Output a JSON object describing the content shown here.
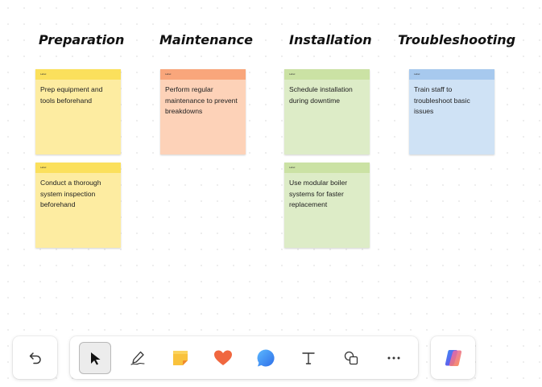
{
  "columns": [
    {
      "title": "Preparation"
    },
    {
      "title": "Maintenance"
    },
    {
      "title": "Installation"
    },
    {
      "title": "Troubleshooting"
    }
  ],
  "notes": [
    {
      "tag": "Label",
      "text": "Prep equipment and tools beforehand",
      "color": "#fdeca1"
    },
    {
      "tag": "Label",
      "text": "Conduct a thorough system inspection beforehand",
      "color": "#fdeca1"
    },
    {
      "tag": "Label",
      "text": "Perform regular maintenance to prevent breakdowns",
      "color": "#fdd2b8"
    },
    {
      "tag": "Label",
      "text": "Schedule installation during downtime",
      "color": "#ddecc7"
    },
    {
      "tag": "Label",
      "text": "Use modular boiler systems for faster replacement",
      "color": "#ddecc7"
    },
    {
      "tag": "Label",
      "text": "Train staff to troubleshoot basic issues",
      "color": "#cfe2f5"
    }
  ],
  "toolbar": {
    "undo_icon": "undo-icon",
    "tools": [
      "select-pointer-icon",
      "pen-icon",
      "sticky-note-icon",
      "reaction-heart-icon",
      "comment-icon",
      "text-icon",
      "shapes-icon",
      "more-icon"
    ],
    "copilot_icon": "copilot-icon",
    "active_tool": "select-pointer-icon"
  }
}
